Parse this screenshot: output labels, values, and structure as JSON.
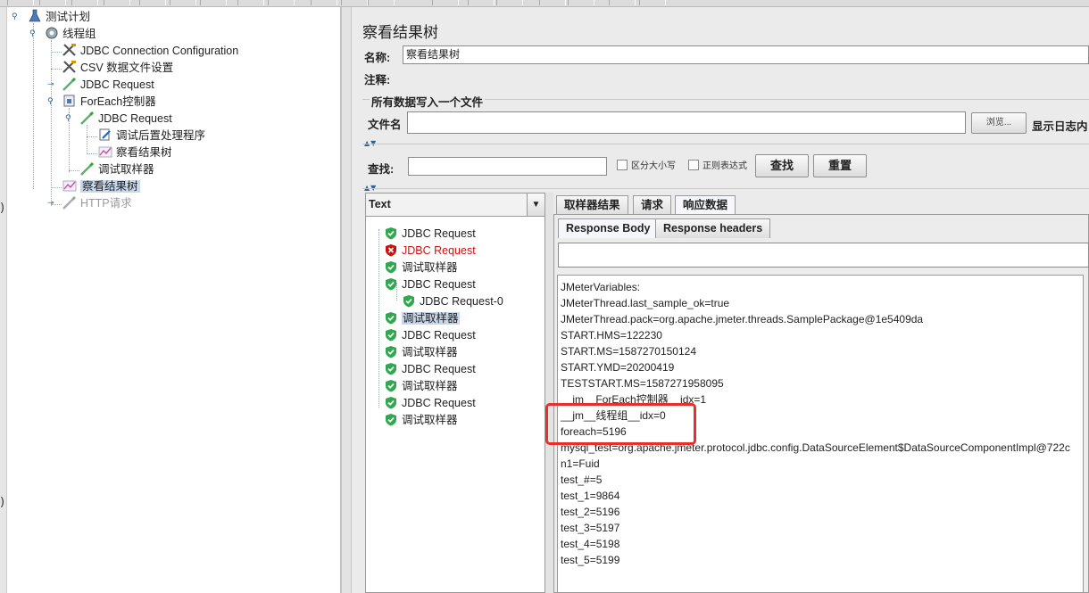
{
  "test_plan_tree": [
    {
      "label": "测试计划",
      "icon": "test-plan-icon"
    },
    {
      "label": "线程组",
      "icon": "gear-icon"
    },
    {
      "label": "JDBC Connection Configuration",
      "icon": "wrench-icon"
    },
    {
      "label": "CSV 数据文件设置",
      "icon": "wrench-icon"
    },
    {
      "label": "JDBC Request",
      "icon": "pipette-icon"
    },
    {
      "label": "ForEach控制器",
      "icon": "controller-icon"
    },
    {
      "label": "JDBC Request",
      "icon": "pipette-icon"
    },
    {
      "label": "调试后置处理程序",
      "icon": "postprocessor-icon"
    },
    {
      "label": "察看结果树",
      "icon": "graph-icon"
    },
    {
      "label": "调试取样器",
      "icon": "pipette-icon"
    },
    {
      "label": "察看结果树",
      "icon": "graph-icon"
    },
    {
      "label": "HTTP请求",
      "icon": "pipette-icon"
    }
  ],
  "panel": {
    "title": "察看结果树",
    "name_label": "名称:",
    "name_value": "察看结果树",
    "comment_label": "注释:",
    "file_section_title": "所有数据写入一个文件",
    "filename_label": "文件名",
    "browse_label": "浏览...",
    "log_label": "显示日志内"
  },
  "search": {
    "label": "查找:",
    "case_label": "区分大小写",
    "regex_label": "正则表达式",
    "find_label": "查找",
    "reset_label": "重置"
  },
  "results": {
    "renderer": "Text",
    "items": [
      {
        "label": "JDBC Request",
        "status": "success"
      },
      {
        "label": "JDBC Request",
        "status": "error"
      },
      {
        "label": "调试取样器",
        "status": "success"
      },
      {
        "label": "JDBC Request",
        "status": "success"
      },
      {
        "label": "JDBC Request-0",
        "status": "success"
      },
      {
        "label": "调试取样器",
        "status": "success"
      },
      {
        "label": "JDBC Request",
        "status": "success"
      },
      {
        "label": "调试取样器",
        "status": "success"
      },
      {
        "label": "JDBC Request",
        "status": "success"
      },
      {
        "label": "调试取样器",
        "status": "success"
      },
      {
        "label": "JDBC Request",
        "status": "success"
      },
      {
        "label": "调试取样器",
        "status": "success"
      }
    ]
  },
  "tabs": {
    "sampler_result": "取样器结果",
    "request": "请求",
    "response_data": "响应数据",
    "response_body": "Response Body",
    "response_headers": "Response headers"
  },
  "response_body_lines": [
    "JMeterVariables:",
    "JMeterThread.last_sample_ok=true",
    "JMeterThread.pack=org.apache.jmeter.threads.SamplePackage@1e5409da",
    "START.HMS=122230",
    "START.MS=1587270150124",
    "START.YMD=20200419",
    "TESTSTART.MS=1587271958095",
    "__jm__ForEach控制器__idx=1",
    "__jm__线程组__idx=0",
    "foreach=5196",
    "mysql_test=org.apache.jmeter.protocol.jdbc.config.DataSourceElement$DataSourceComponentImpl@722c",
    "n1=Fuid",
    "test_#=5",
    "test_1=9864",
    "test_2=5196",
    "test_3=5197",
    "test_4=5198",
    "test_5=5199"
  ],
  "colors": {
    "highlight": "#e8302a",
    "error_text": "#cc1111",
    "success_shield": "#2fa84f",
    "selection": "#c8d8ea"
  }
}
